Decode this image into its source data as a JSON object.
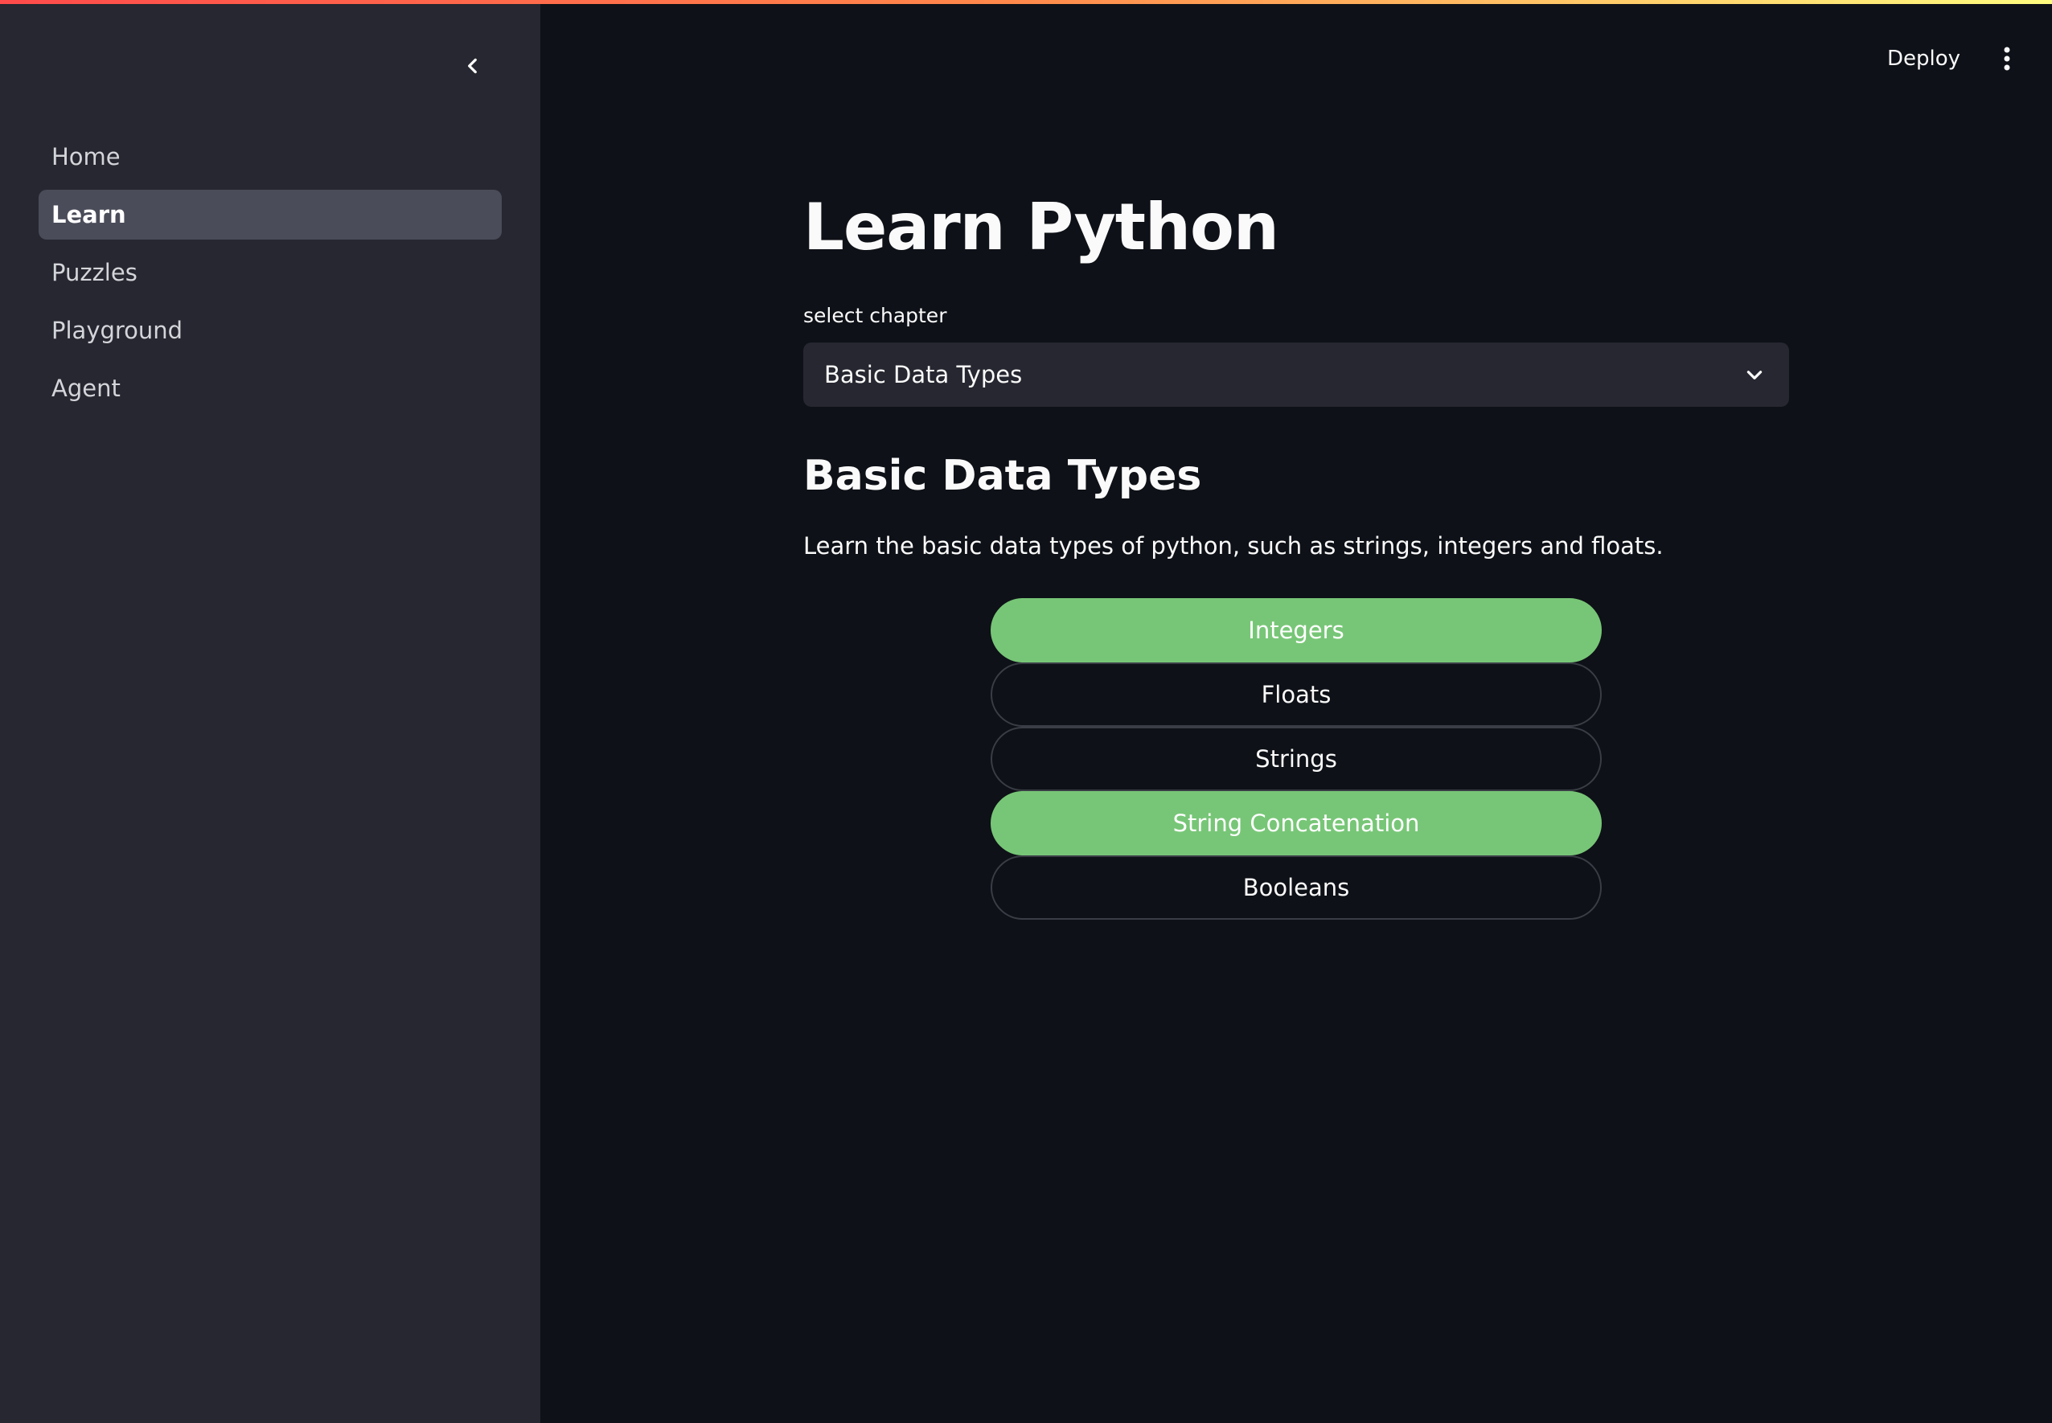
{
  "sidebar": {
    "collapse_icon": "chevron-left-icon",
    "items": [
      {
        "label": "Home",
        "active": false
      },
      {
        "label": "Learn",
        "active": true
      },
      {
        "label": "Puzzles",
        "active": false
      },
      {
        "label": "Playground",
        "active": false
      },
      {
        "label": "Agent",
        "active": false
      }
    ]
  },
  "header": {
    "deploy_label": "Deploy",
    "menu_icon": "more-vertical-icon"
  },
  "main": {
    "title": "Learn Python",
    "select": {
      "label": "select chapter",
      "value": "Basic Data Types",
      "icon": "chevron-down-icon"
    },
    "chapter_heading": "Basic Data Types",
    "chapter_description": "Learn the basic data types of python, such as strings, integers and floats.",
    "lessons": [
      {
        "label": "Integers",
        "completed": true
      },
      {
        "label": "Floats",
        "completed": false
      },
      {
        "label": "Strings",
        "completed": false
      },
      {
        "label": "String Concatenation",
        "completed": true
      },
      {
        "label": "Booleans",
        "completed": false
      }
    ]
  },
  "colors": {
    "background": "#0e1117",
    "sidebar": "#262730",
    "active_nav": "#4a4c59",
    "completed_lesson": "#77c677"
  }
}
